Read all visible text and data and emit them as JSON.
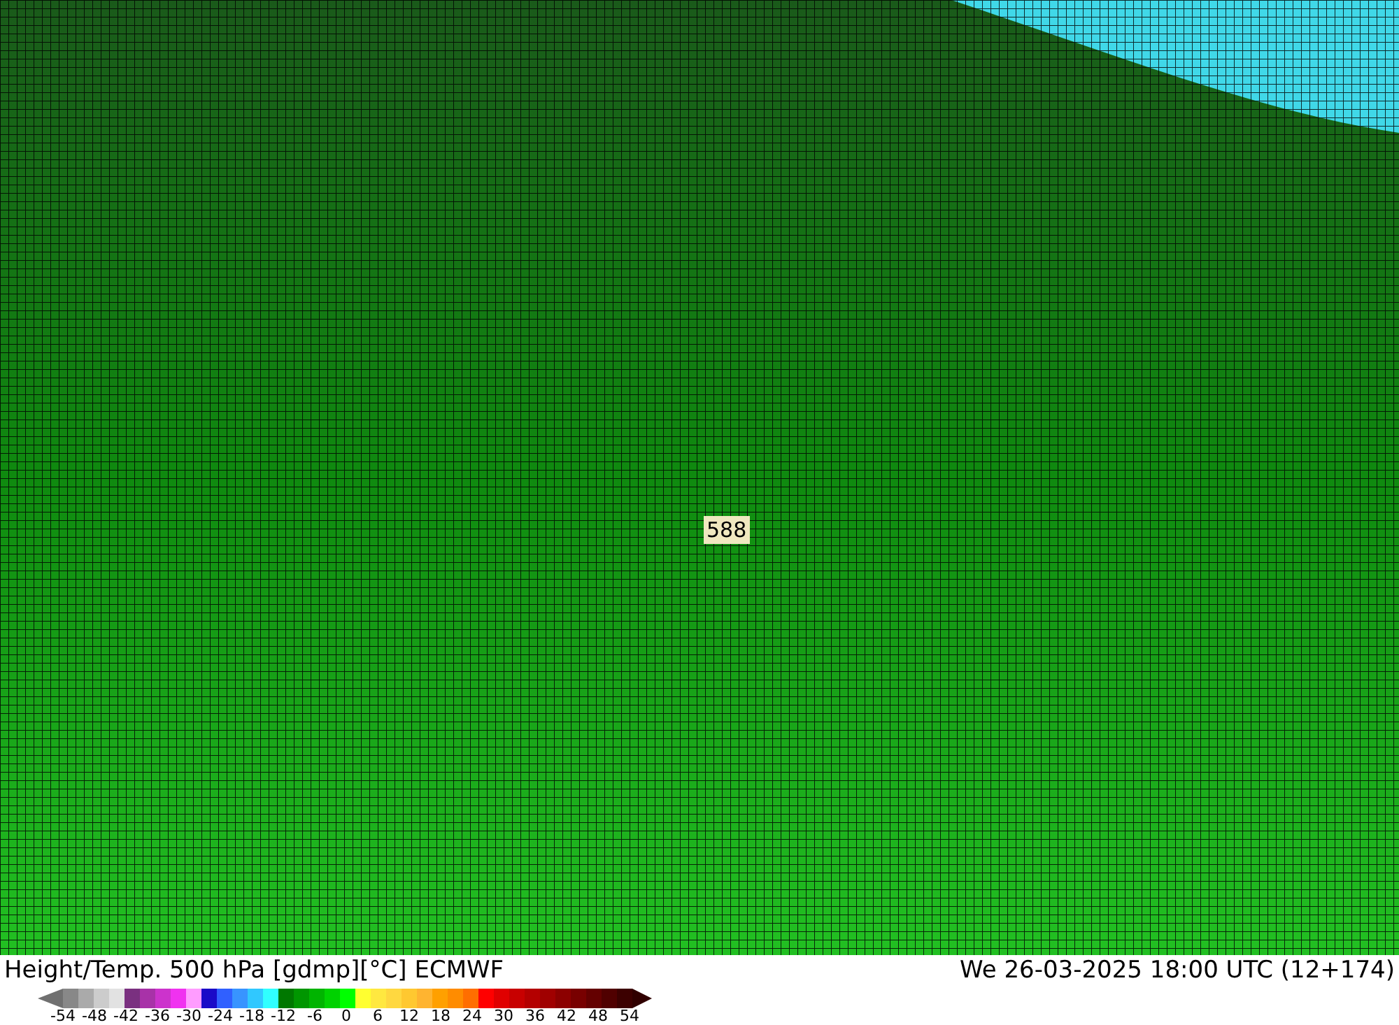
{
  "map": {
    "contour_label": "588"
  },
  "title": {
    "left": "Height/Temp. 500 hPa [gdmp][°C] ECMWF",
    "right": "We 26-03-2025 18:00 UTC (12+174)"
  },
  "legend": {
    "segments": [
      {
        "color": "#888888"
      },
      {
        "color": "#aaaaaa"
      },
      {
        "color": "#cccccc"
      },
      {
        "color": "#e2e2e2"
      },
      {
        "color": "#7a3080"
      },
      {
        "color": "#a832a8"
      },
      {
        "color": "#cc33cc"
      },
      {
        "color": "#f032f0"
      },
      {
        "color": "#ff9cff"
      },
      {
        "color": "#1a0ac8"
      },
      {
        "color": "#3060ff"
      },
      {
        "color": "#3894ff"
      },
      {
        "color": "#30c8ff"
      },
      {
        "color": "#30ffff"
      },
      {
        "color": "#007800"
      },
      {
        "color": "#009600"
      },
      {
        "color": "#00b400"
      },
      {
        "color": "#00d200"
      },
      {
        "color": "#00ff00"
      },
      {
        "color": "#ffff30"
      },
      {
        "color": "#ffe840"
      },
      {
        "color": "#ffd840"
      },
      {
        "color": "#ffc830"
      },
      {
        "color": "#ffb430"
      },
      {
        "color": "#ffa000"
      },
      {
        "color": "#ff8c00"
      },
      {
        "color": "#ff6e00"
      },
      {
        "color": "#ff0000"
      },
      {
        "color": "#e00000"
      },
      {
        "color": "#c80000"
      },
      {
        "color": "#b40000"
      },
      {
        "color": "#a00000"
      },
      {
        "color": "#8c0000"
      },
      {
        "color": "#780000"
      },
      {
        "color": "#640000"
      },
      {
        "color": "#500000"
      },
      {
        "color": "#3c0000"
      }
    ],
    "ticks": [
      "-54",
      "-48",
      "-42",
      "-36",
      "-30",
      "-24",
      "-18",
      "-12",
      "-6",
      "0",
      "6",
      "12",
      "18",
      "24",
      "30",
      "36",
      "42",
      "48",
      "54"
    ]
  }
}
